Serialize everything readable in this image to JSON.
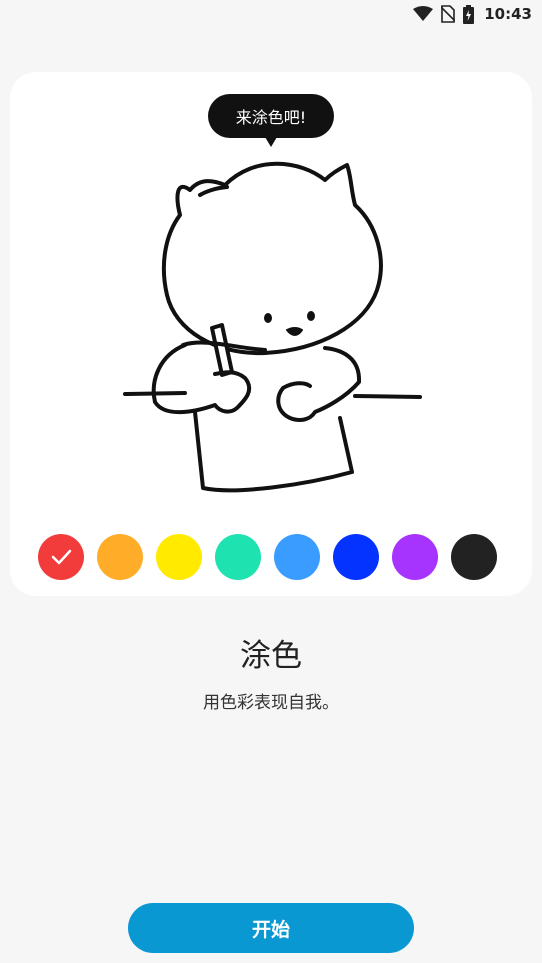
{
  "status_bar": {
    "time": "10:43",
    "icons": [
      "wifi-icon",
      "no-sim-icon",
      "battery-charging-icon"
    ]
  },
  "card": {
    "speech_bubble": "来涂色吧!",
    "illustration": "cat-drawing-illustration",
    "swatches": [
      {
        "name": "red",
        "color": "#f23c3c",
        "selected": true
      },
      {
        "name": "orange",
        "color": "#ffad29",
        "selected": false
      },
      {
        "name": "yellow",
        "color": "#ffea00",
        "selected": false
      },
      {
        "name": "teal",
        "color": "#1ee3b1",
        "selected": false
      },
      {
        "name": "sky-blue",
        "color": "#3b9cff",
        "selected": false
      },
      {
        "name": "blue",
        "color": "#0433ff",
        "selected": false
      },
      {
        "name": "purple",
        "color": "#a733ff",
        "selected": false
      },
      {
        "name": "black",
        "color": "#222222",
        "selected": false
      }
    ]
  },
  "feature": {
    "title": "涂色",
    "subtitle": "用色彩表现自我。"
  },
  "start_button": {
    "label": "开始",
    "color": "#0a98d2"
  }
}
